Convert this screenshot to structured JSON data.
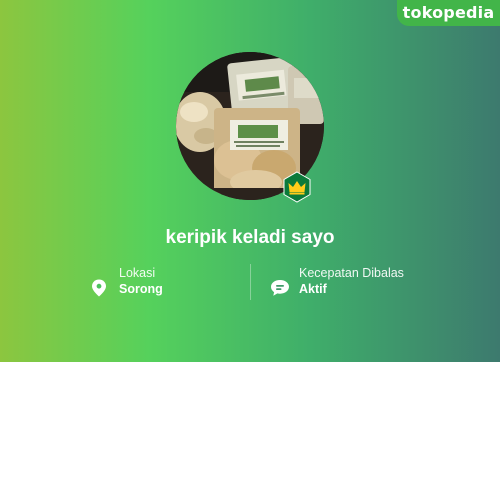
{
  "brand": {
    "logo_text": "tokopedia",
    "color": "#42b549"
  },
  "banner": {
    "gradient_start": "#8cc63f",
    "gradient_end": "#3d7a6e"
  },
  "shop": {
    "name": "keripik keladi sayo",
    "badge_icon": "crown-icon",
    "badge_color": "#0b7a3a"
  },
  "info": {
    "location": {
      "icon": "map-pin-icon",
      "label": "Lokasi",
      "value": "Sorong"
    },
    "response": {
      "icon": "chat-bubble-icon",
      "label": "Kecepatan Dibalas",
      "value": "Aktif"
    }
  }
}
